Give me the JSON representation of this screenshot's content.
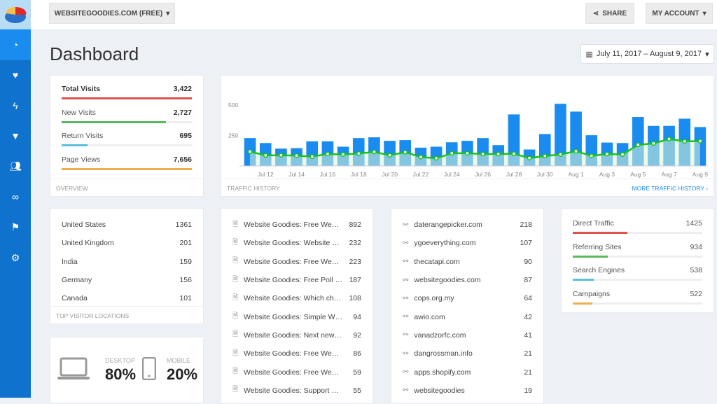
{
  "header": {
    "site_selector": "WEBSITEGOODIES.COM (FREE)",
    "share": "SHARE",
    "account": "MY ACCOUNT"
  },
  "sidebar": {
    "items": [
      "dashboard",
      "health",
      "activity",
      "funnel",
      "visitors",
      "links",
      "flag",
      "settings"
    ]
  },
  "page_title": "Dashboard",
  "date_range": "July 11, 2017 – August 9, 2017",
  "overview": {
    "footer": "OVERVIEW",
    "stats": [
      {
        "label": "Total Visits",
        "value": "3,422",
        "fill": 1.0,
        "color": "#d9534f"
      },
      {
        "label": "New Visits",
        "value": "2,727",
        "fill": 0.8,
        "color": "#5cb85c"
      },
      {
        "label": "Return Visits",
        "value": "695",
        "fill": 0.2,
        "color": "#5bc0de"
      },
      {
        "label": "Page Views",
        "value": "7,656",
        "fill": 1.0,
        "color": "#f0ad4e"
      }
    ]
  },
  "traffic": {
    "footer": "TRAFFIC HISTORY",
    "more": "MORE TRAFFIC HISTORY ›"
  },
  "chart_data": {
    "type": "bar",
    "ylim": [
      0,
      500
    ],
    "yticks": [
      "250",
      "500"
    ],
    "x": [
      "Jul 11",
      "Jul 12",
      "Jul 13",
      "Jul 14",
      "Jul 15",
      "Jul 16",
      "Jul 17",
      "Jul 18",
      "Jul 19",
      "Jul 20",
      "Jul 21",
      "Jul 22",
      "Jul 23",
      "Jul 24",
      "Jul 25",
      "Jul 26",
      "Jul 27",
      "Jul 28",
      "Jul 29",
      "Jul 30",
      "Jul 31",
      "Aug 1",
      "Aug 2",
      "Aug 3",
      "Aug 4",
      "Aug 5",
      "Aug 6",
      "Aug 7",
      "Aug 8",
      "Aug 9"
    ],
    "xticks": [
      "Jul 12",
      "Jul 14",
      "Jul 16",
      "Jul 18",
      "Jul 20",
      "Jul 22",
      "Jul 24",
      "Jul 26",
      "Jul 28",
      "Jul 30",
      "Aug 1",
      "Aug 3",
      "Aug 5",
      "Aug 7",
      "Aug 9"
    ],
    "series": [
      {
        "type": "bar",
        "color": "#1a8cf0",
        "values": [
          229,
          188,
          142,
          146,
          202,
          202,
          158,
          229,
          235,
          206,
          212,
          150,
          158,
          194,
          206,
          229,
          171,
          423,
          135,
          262,
          510,
          446,
          252,
          192,
          188,
          402,
          329,
          329,
          388,
          319
        ]
      },
      {
        "type": "line",
        "color": "#19c119",
        "values": [
          117,
          87,
          88,
          85,
          77,
          98,
          94,
          102,
          115,
          88,
          113,
          73,
          63,
          104,
          104,
          98,
          98,
          100,
          65,
          81,
          94,
          121,
          83,
          98,
          94,
          173,
          185,
          221,
          202,
          204
        ]
      }
    ]
  },
  "locations": {
    "footer": "TOP VISITOR LOCATIONS",
    "rows": [
      {
        "name": "United States",
        "value": "1361"
      },
      {
        "name": "United Kingdom",
        "value": "201"
      },
      {
        "name": "India",
        "value": "159"
      },
      {
        "name": "Germany",
        "value": "156"
      },
      {
        "name": "Canada",
        "value": "101"
      }
    ]
  },
  "pages": {
    "rows": [
      {
        "name": "Website Goodies: Free We…",
        "value": "892"
      },
      {
        "name": "Website Goodies: Website …",
        "value": "232"
      },
      {
        "name": "Website Goodies: Free We…",
        "value": "223"
      },
      {
        "name": "Website Goodies: Free Poll …",
        "value": "187"
      },
      {
        "name": "Website Goodies: Which ch…",
        "value": "108"
      },
      {
        "name": "Website Goodies: Simple W…",
        "value": "94"
      },
      {
        "name": "Website Goodies: Next new…",
        "value": "92"
      },
      {
        "name": "Website Goodies: Free We…",
        "value": "86"
      },
      {
        "name": "Website Goodies: Free We…",
        "value": "59"
      },
      {
        "name": "Website Goodies: Support …",
        "value": "55"
      }
    ]
  },
  "referrers": {
    "rows": [
      {
        "name": "daterangepicker.com",
        "value": "218"
      },
      {
        "name": "ygoeverything.com",
        "value": "107"
      },
      {
        "name": "thecatapi.com",
        "value": "90"
      },
      {
        "name": "websitegoodies.com",
        "value": "87"
      },
      {
        "name": "cops.org.my",
        "value": "64"
      },
      {
        "name": "awio.com",
        "value": "42"
      },
      {
        "name": "vanadzorfc.com",
        "value": "41"
      },
      {
        "name": "dangrossman.info",
        "value": "21"
      },
      {
        "name": "apps.shopify.com",
        "value": "21"
      },
      {
        "name": "websitegoodies",
        "value": "19"
      }
    ]
  },
  "sources": {
    "rows": [
      {
        "label": "Direct Traffic",
        "value": "1425",
        "fill": 0.42,
        "color": "#d9534f"
      },
      {
        "label": "Referring Sites",
        "value": "934",
        "fill": 0.27,
        "color": "#5cb85c"
      },
      {
        "label": "Search Engines",
        "value": "538",
        "fill": 0.16,
        "color": "#5bc0de"
      },
      {
        "label": "Campaigns",
        "value": "522",
        "fill": 0.15,
        "color": "#f0ad4e"
      }
    ]
  },
  "devices": {
    "desktop_label": "DESKTOP",
    "desktop_value": "80%",
    "mobile_label": "MOBILE",
    "mobile_value": "20%"
  }
}
